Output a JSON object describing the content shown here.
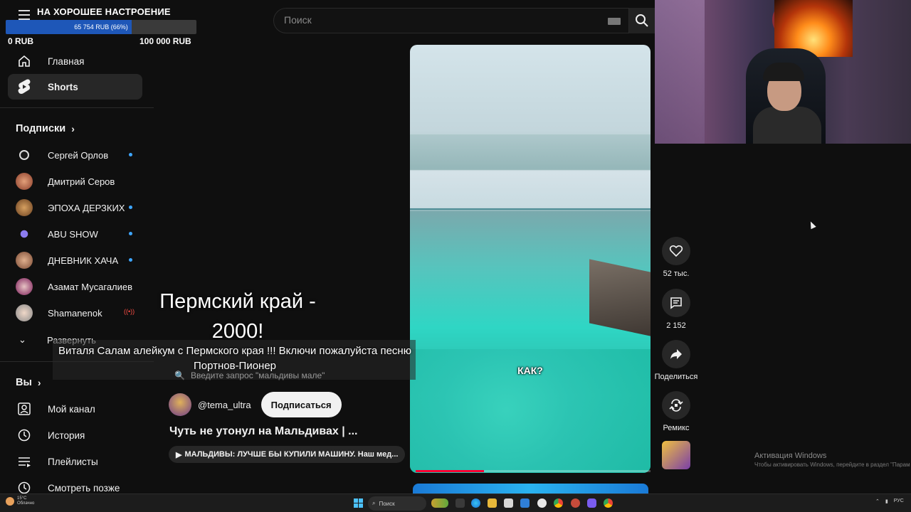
{
  "donation": {
    "title": "НА ХОРОШЕЕ НАСТРОЕНИЕ",
    "progress_label": "65 754 RUB (66%)",
    "progress_fraction": 0.66,
    "min_label": "0 RUB",
    "max_label": "100 000 RUB",
    "bar_color": "#1e57b8"
  },
  "search": {
    "placeholder": "Поиск",
    "icon": "search-icon",
    "keyboard_icon": "keyboard-icon"
  },
  "sidebar": {
    "nav": [
      {
        "label": "Главная",
        "icon": "home-icon"
      },
      {
        "label": "Shorts",
        "icon": "shorts-icon",
        "active": true
      }
    ],
    "subscriptions_title": "Подписки",
    "subscriptions": [
      {
        "label": "Сергей Орлов",
        "new": true,
        "avatar_color": "#1a1a1a"
      },
      {
        "label": "Дмитрий Серов",
        "new": false,
        "avatar_color": "#a85a3a"
      },
      {
        "label": "ЭПОХА ДЕРЗКИХ",
        "new": true,
        "avatar_color": "#b9773a"
      },
      {
        "label": "ABU SHOW",
        "new": true,
        "avatar_color": "#5a4fd6"
      },
      {
        "label": "ДНЕВНИК ХАЧА",
        "new": true,
        "avatar_color": "#c08b6e"
      },
      {
        "label": "Азамат Мусагалиев",
        "new": false,
        "avatar_color": "#8a2b6b"
      },
      {
        "label": "Shamanenok",
        "live": true,
        "avatar_color": "#c8c8c8"
      }
    ],
    "expand_label": "Развернуть",
    "you_title": "Вы",
    "you_items": [
      {
        "label": "Мой канал",
        "icon": "channel-icon"
      },
      {
        "label": "История",
        "icon": "history-icon"
      },
      {
        "label": "Плейлисты",
        "icon": "playlist-icon"
      },
      {
        "label": "Смотреть позже",
        "icon": "watch-later-icon"
      }
    ]
  },
  "short": {
    "caption": "КАК?",
    "progress_fraction": 0.29,
    "channel_handle": "@tema_ultra",
    "subscribe_label": "Подписаться",
    "title": "Чуть не утонул на Мальдивах | ...",
    "music": "МАЛЬДИВЫ: ЛУЧШЕ БЫ КУПИЛИ МАШИНУ. Наш мед...",
    "accent": "#ff0033"
  },
  "actions": {
    "like_count": "52 тыс.",
    "comment_count": "2 152",
    "share_label": "Поделиться",
    "remix_label": "Ремикс"
  },
  "stream_overlay": {
    "big_line1": "Пермский край  -",
    "big_line2": "2000!",
    "message": "Виталя Салам алейкум с Пермского края !!! Включи пожалуйста песню Портнов-Пионер",
    "mini_search_placeholder": "Введите запрос \"мальдивы мале\""
  },
  "windows": {
    "activation_title": "Активация Windows",
    "activation_sub": "Чтобы активировать Windows, перейдите в раздел \"Парам",
    "weather_temp": "15°C",
    "weather_desc": "Облачно",
    "taskbar_search": "Поиск",
    "tray_lang": "РУС"
  }
}
